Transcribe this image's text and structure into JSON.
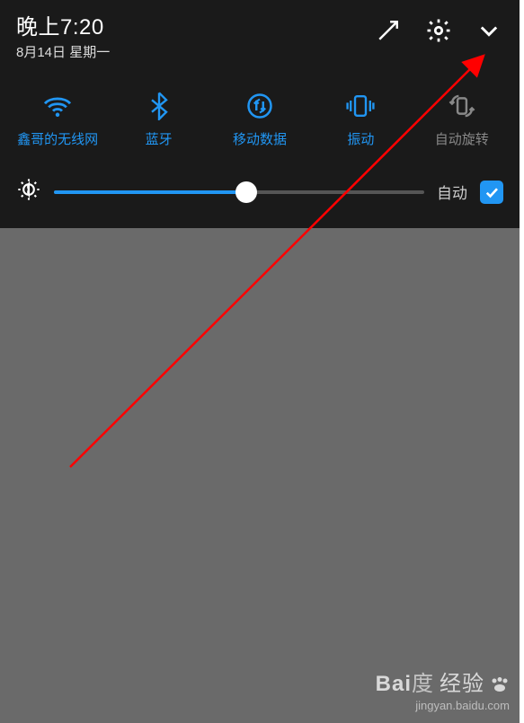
{
  "statusbar": {
    "time": "晚上7:20",
    "date": "8月14日 星期一"
  },
  "toggles": [
    {
      "id": "wifi",
      "label": "鑫哥的无线网",
      "active": true
    },
    {
      "id": "bluetooth",
      "label": "蓝牙",
      "active": true
    },
    {
      "id": "mobiledata",
      "label": "移动数据",
      "active": true
    },
    {
      "id": "vibrate",
      "label": "振动",
      "active": true
    },
    {
      "id": "autorotate",
      "label": "自动旋转",
      "active": false
    }
  ],
  "brightness": {
    "auto_label": "自动",
    "auto_checked": true,
    "value_percent": 52
  },
  "colors": {
    "accent": "#2196f3",
    "inactive": "#888888",
    "panel_bg": "#1a1a1a",
    "page_bg": "#6a6a6a",
    "arrow": "#ff0000"
  },
  "watermark": {
    "brand": "Bai",
    "brand2": "经验",
    "url": "jingyan.baidu.com"
  }
}
